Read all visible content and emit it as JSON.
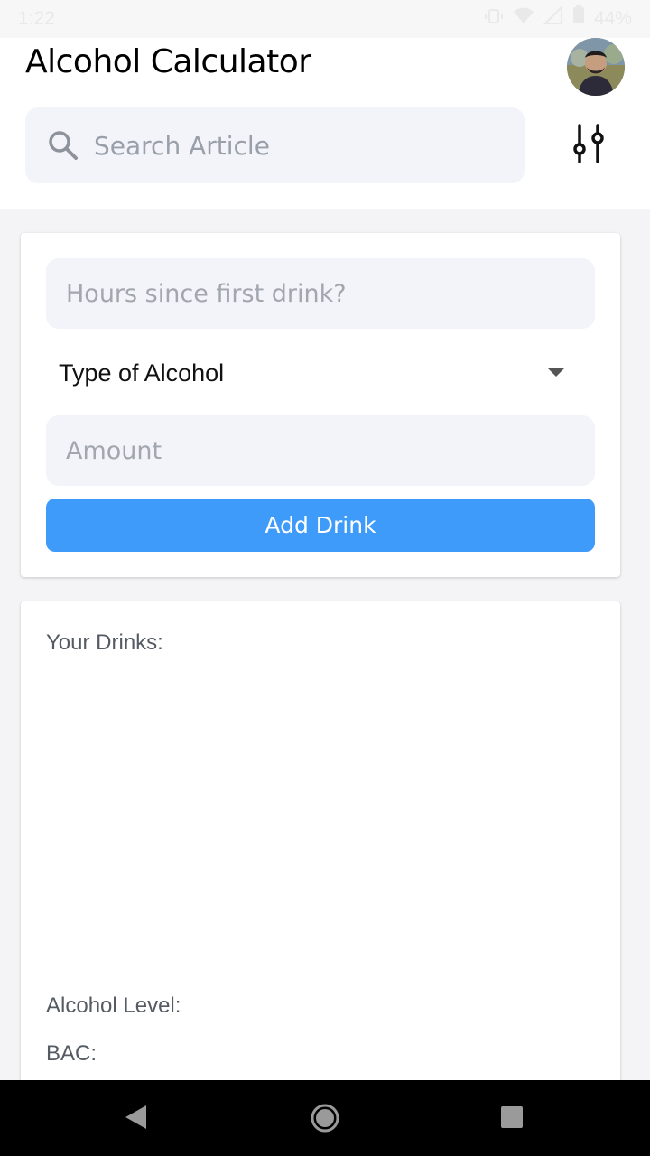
{
  "status_bar": {
    "time": "1:22",
    "battery": "44%"
  },
  "header": {
    "title": "Alcohol Calculator",
    "avatar_icon": "user-avatar",
    "filter_icon": "sliders-icon"
  },
  "search": {
    "placeholder": "Search Article",
    "icon": "search-icon"
  },
  "form": {
    "hours_placeholder": "Hours since first drink?",
    "type_select_label": "Type of Alcohol",
    "amount_placeholder": "Amount",
    "add_button_label": "Add Drink"
  },
  "results": {
    "your_drinks_label": "Your Drinks:",
    "alcohol_level_label": "Alcohol Level:",
    "bac_label": "BAC:"
  },
  "colors": {
    "accent": "#3f9bfa",
    "field_bg": "#f3f4f9",
    "page_bg": "#f4f4f6"
  }
}
